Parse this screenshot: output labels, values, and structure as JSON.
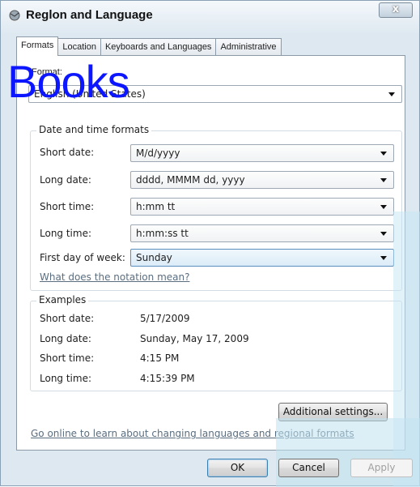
{
  "window": {
    "title": "Reglon and Language",
    "close_label": "x"
  },
  "tabs": [
    "Formats",
    "Location",
    "Keyboards and Languages",
    "Administrative"
  ],
  "overlay": "Books",
  "format": {
    "label": "Format:",
    "value": "English (United States)"
  },
  "date_time": {
    "title": "Date and time formats",
    "rows": [
      {
        "label": "Short date:",
        "value": "M/d/yyyy"
      },
      {
        "label": "Long date:",
        "value": "dddd, MMMM dd, yyyy"
      },
      {
        "label": "Short time:",
        "value": "h:mm tt"
      },
      {
        "label": "Long time:",
        "value": "h:mm:ss tt"
      },
      {
        "label": "First day of week:",
        "value": "Sunday"
      }
    ],
    "notation_link": "What does the notation mean?"
  },
  "examples": {
    "title": "Examples",
    "rows": [
      {
        "label": "Short date:",
        "value": "5/17/2009"
      },
      {
        "label": "Long date:",
        "value": "Sunday, May 17, 2009"
      },
      {
        "label": "Short time:",
        "value": "4:15 PM"
      },
      {
        "label": "Long time:",
        "value": "4:15:39 PM"
      }
    ]
  },
  "additional_settings": "Additional settings...",
  "online_link": "Go online to learn about changing languages and regional formats",
  "buttons": {
    "ok": "OK",
    "cancel": "Cancel",
    "apply": "Apply"
  }
}
